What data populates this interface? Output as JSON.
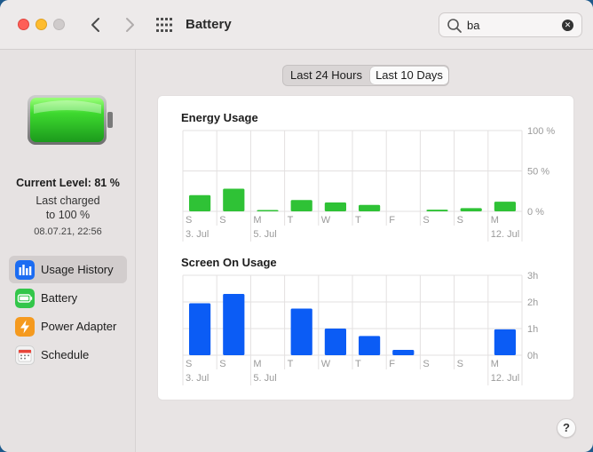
{
  "window": {
    "title": "Battery"
  },
  "search": {
    "value": "ba",
    "placeholder": "Search"
  },
  "icons": {
    "close": "traffic-light-close",
    "minimize": "traffic-light-minimize",
    "zoom": "traffic-light-zoom",
    "back": "chevron-left-icon",
    "forward": "chevron-right-icon",
    "grid": "grid-icon",
    "search": "magnifier-icon",
    "clear": "clear-x-icon",
    "help": "question-icon"
  },
  "colors": {
    "energy": "#2fc236",
    "screen": "#0b5cf5",
    "battery_green": "#3bcf33",
    "close": "#fe5f57",
    "minimize": "#febc2e",
    "usage_history_icon": "#1b6cf2",
    "battery_icon": "#33c64a",
    "power_adapter_icon": "#f59a1f",
    "schedule_icon": "#f2f2f2"
  },
  "sidebar": {
    "current_level": "Current Level: 81 %",
    "last_charged_line1": "Last charged",
    "last_charged_line2": "to 100 %",
    "last_charged_date": "08.07.21, 22:56",
    "items": [
      {
        "label": "Usage History",
        "icon": "bar-chart-icon",
        "selected": true
      },
      {
        "label": "Battery",
        "icon": "battery-icon",
        "selected": false
      },
      {
        "label": "Power Adapter",
        "icon": "lightning-icon",
        "selected": false
      },
      {
        "label": "Schedule",
        "icon": "calendar-icon",
        "selected": false
      }
    ]
  },
  "segmented": {
    "options": [
      "Last 24 Hours",
      "Last 10 Days"
    ],
    "selected": "Last 10 Days"
  },
  "help_label": "?",
  "chart_data": [
    {
      "type": "bar",
      "title": "Energy Usage",
      "categories": [
        "S",
        "S",
        "M",
        "T",
        "W",
        "T",
        "F",
        "S",
        "S",
        "M"
      ],
      "date_labels": [
        "3. Jul",
        "",
        "5. Jul",
        "",
        "",
        "",
        "",
        "",
        "",
        "12. Jul"
      ],
      "values": [
        20,
        28,
        1,
        14,
        11,
        8,
        0,
        2,
        4,
        12
      ],
      "yticks": [
        "100 %",
        "50 %",
        "0 %"
      ],
      "ylim": [
        0,
        100
      ],
      "grid": true
    },
    {
      "type": "bar",
      "title": "Screen On Usage",
      "categories": [
        "S",
        "S",
        "M",
        "T",
        "W",
        "T",
        "F",
        "S",
        "S",
        "M"
      ],
      "date_labels": [
        "3. Jul",
        "",
        "5. Jul",
        "",
        "",
        "",
        "",
        "",
        "",
        "12. Jul"
      ],
      "values": [
        1.95,
        2.3,
        0,
        1.75,
        1.0,
        0.72,
        0.2,
        0,
        0,
        0.97
      ],
      "yticks": [
        "3h",
        "2h",
        "1h",
        "0h"
      ],
      "ylim": [
        0,
        3
      ],
      "grid": true
    }
  ]
}
